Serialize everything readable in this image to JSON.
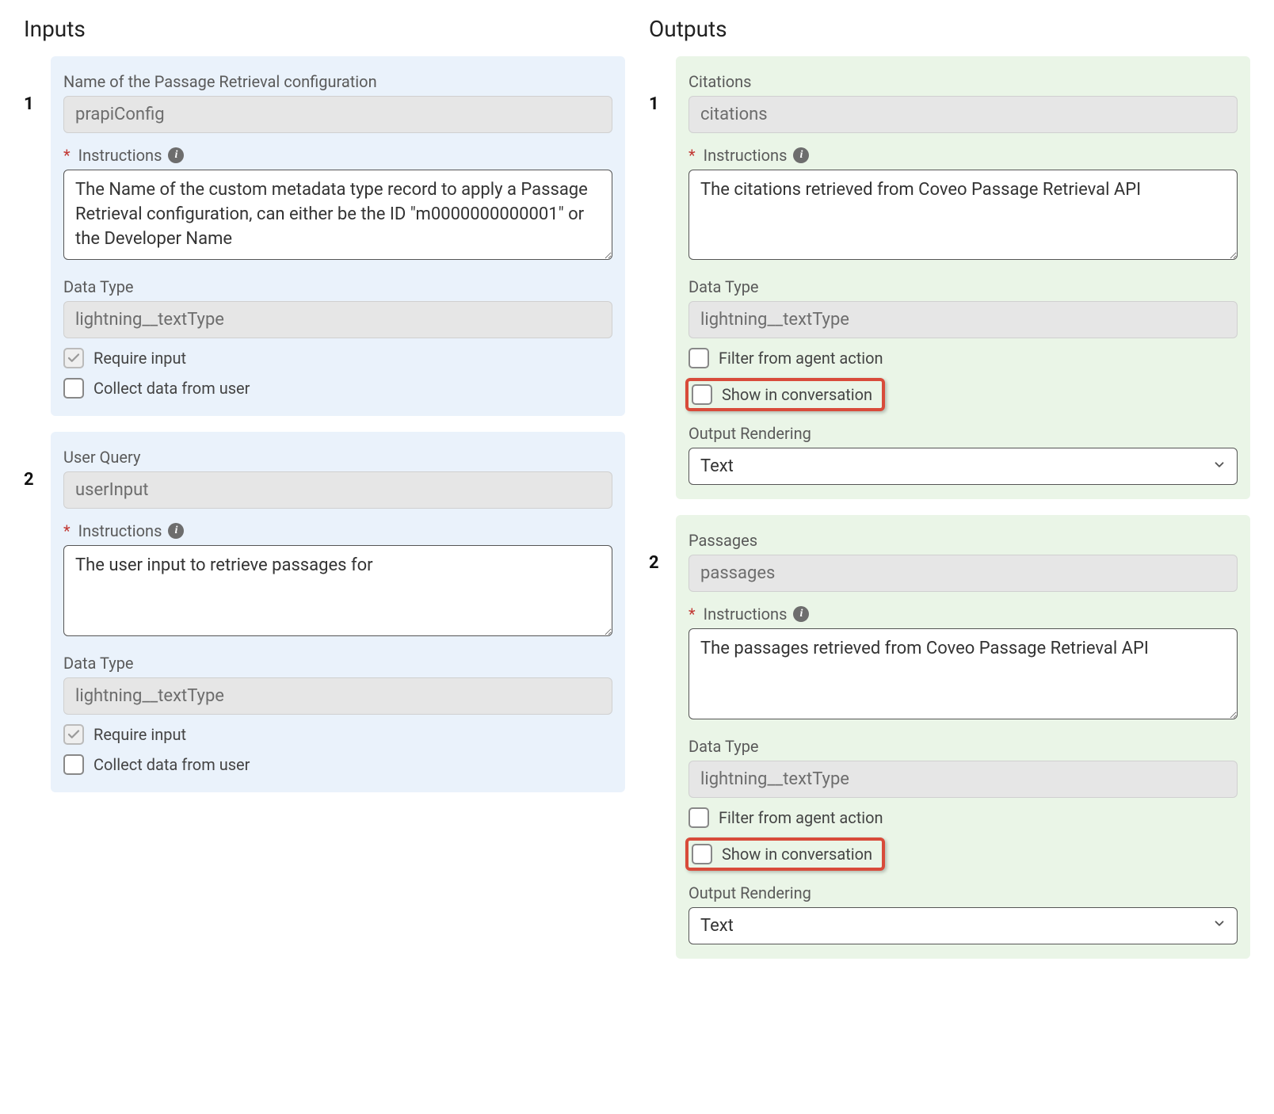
{
  "headings": {
    "inputs": "Inputs",
    "outputs": "Outputs"
  },
  "labels": {
    "instructions": "Instructions",
    "data_type": "Data Type",
    "require_input": "Require input",
    "collect_from_user": "Collect data from user",
    "filter_from_agent": "Filter from agent action",
    "show_in_conversation": "Show in conversation",
    "output_rendering": "Output Rendering"
  },
  "common": {
    "data_type_value": "lightning__textType",
    "rendering_value": "Text"
  },
  "inputs": [
    {
      "num": "1",
      "title": "Name of the Passage Retrieval configuration",
      "name_value": "prapiConfig",
      "instructions": "The Name of the custom metadata type record to apply a Passage Retrieval configuration, can either be the ID \"m0000000000001\" or the Developer Name",
      "require_input": true,
      "collect_from_user": false
    },
    {
      "num": "2",
      "title": "User Query",
      "name_value": "userInput",
      "instructions": "The user input to retrieve passages for",
      "require_input": true,
      "collect_from_user": false
    }
  ],
  "outputs": [
    {
      "num": "1",
      "title": "Citations",
      "name_value": "citations",
      "instructions": "The citations retrieved from Coveo Passage Retrieval API",
      "filter_from_agent": false,
      "show_in_conversation": false
    },
    {
      "num": "2",
      "title": "Passages",
      "name_value": "passages",
      "instructions": "The passages retrieved from Coveo Passage Retrieval API",
      "filter_from_agent": false,
      "show_in_conversation": false
    }
  ]
}
